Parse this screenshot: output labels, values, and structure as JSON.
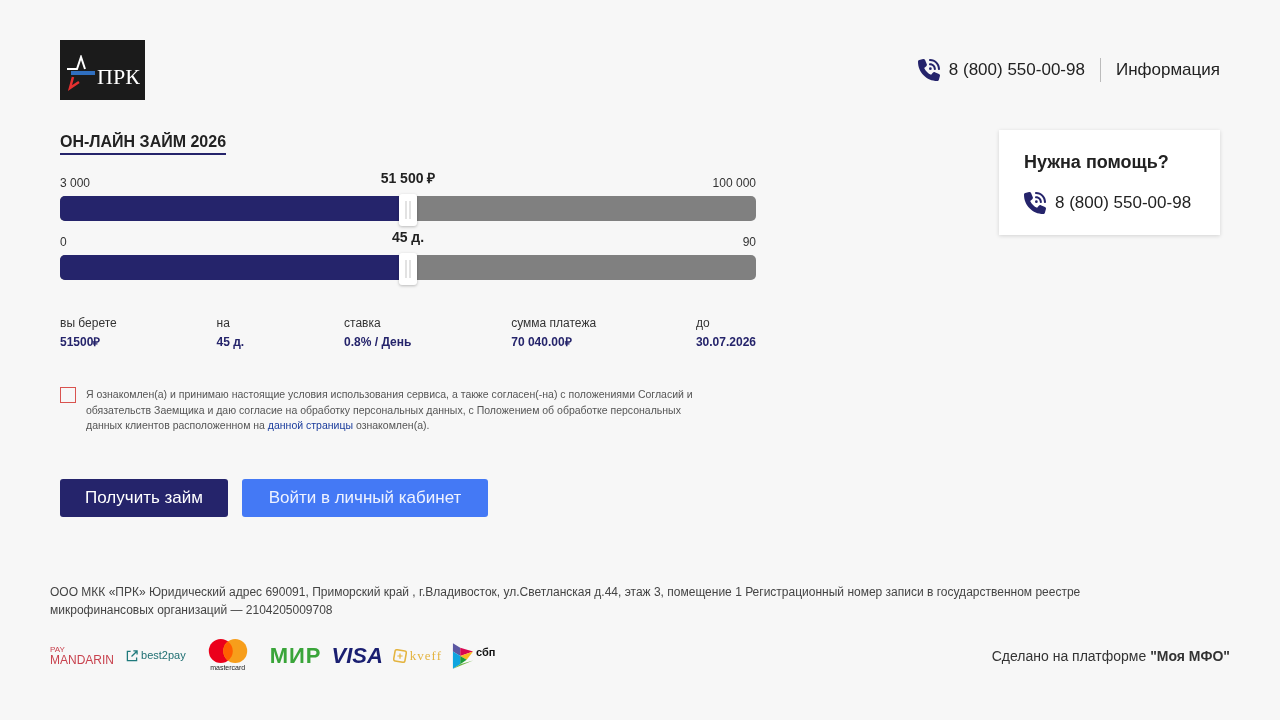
{
  "header": {
    "logo": {
      "text": "ПРК"
    },
    "phone": "8 (800) 550-00-98",
    "info_link": "Информация"
  },
  "calculator": {
    "title": "ОН-ЛАЙН ЗАЙМ 2026",
    "sliders": [
      {
        "min_label": "3 000",
        "max_label": "100 000",
        "value_label": "51 500 ₽",
        "level": 0.5
      },
      {
        "min_label": "0",
        "max_label": "90",
        "value_label": "45 д.",
        "level": 0.5
      }
    ],
    "summary": [
      {
        "label": "вы берете",
        "value": "51500₽"
      },
      {
        "label": "на",
        "value": "45 д."
      },
      {
        "label": "ставка",
        "value": "0.8% / День"
      },
      {
        "label": "сумма платежа",
        "value": "70 040.00₽"
      },
      {
        "label": "до",
        "value": "30.07.2026"
      }
    ],
    "consent": {
      "checked": false,
      "text_before": "Я ознакомлен(а) и принимаю настоящие условия использования сервиса, а также согласен(-на) с положениями Согласий и обязательств Заемщика и даю согласие на обработку персональных данных, с Положением об обработке персональных данных клиентов расположенном на",
      "link": "данной страницы",
      "text_after": "ознакомлен(а)."
    },
    "buttons": [
      {
        "label": "Получить займ",
        "kind": "primary"
      },
      {
        "label": "Войти в личный кабинет",
        "kind": "secondary"
      }
    ]
  },
  "help_card": {
    "title": "Нужна помощь?",
    "phone": "8 (800) 550-00-98"
  },
  "footer": {
    "legal_text": "ООО МКК «ПРК» Юридический адрес 690091, Приморский край , г.Владивосток, ул.Светланская д.44, этаж 3, помещение 1 Регистрационный номер записи в государственном реестре микрофинансовых организаций — 2104205009708",
    "payment_logos": [
      {
        "kind": "mandarin",
        "caption": "PAY",
        "text": "MANDARIN"
      },
      {
        "kind": "best2pay",
        "text": "best2pay"
      },
      {
        "kind": "mastercard",
        "text": "mastercard"
      },
      {
        "kind": "mir",
        "text": "МИР"
      },
      {
        "kind": "visa",
        "text": "VISA"
      },
      {
        "kind": "kveff",
        "text": "kveff"
      },
      {
        "kind": "sbp",
        "text": "сбп"
      }
    ],
    "platform_text": "Сделано на платформе **\"Моя МФО\"**"
  }
}
